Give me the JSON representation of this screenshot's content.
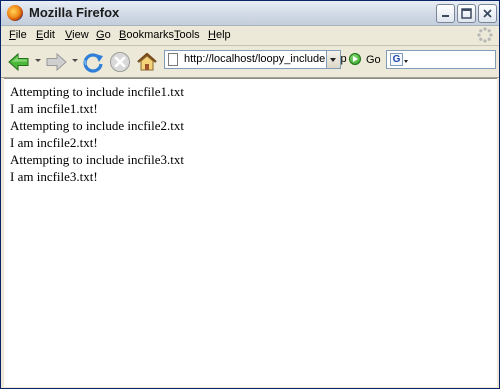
{
  "window": {
    "title": "Mozilla Firefox"
  },
  "menu": {
    "items": [
      {
        "underline": "F",
        "rest": "ile"
      },
      {
        "underline": "E",
        "rest": "dit"
      },
      {
        "underline": "V",
        "rest": "iew"
      },
      {
        "underline": "G",
        "rest": "o"
      },
      {
        "underline": "B",
        "rest": "ookmarks"
      },
      {
        "underline": "T",
        "rest": "ools"
      },
      {
        "underline": "H",
        "rest": "elp"
      }
    ]
  },
  "toolbar": {
    "url": "http://localhost/loopy_include.php",
    "go_label": "Go",
    "search_engine_letter": "G",
    "search_value": ""
  },
  "content": {
    "lines": [
      "Attempting to include incfile1.txt",
      "I am incfile1.txt!",
      "Attempting to include incfile2.txt",
      "I am incfile2.txt!",
      "Attempting to include incfile3.txt",
      "I am incfile3.txt!"
    ]
  },
  "colors": {
    "title_bar": "#d2dbe6",
    "chrome": "#ece9d8",
    "page_background": "#ffffff",
    "back_arrow": "#3aa32a",
    "reload_arrow": "#2f7fd8"
  }
}
